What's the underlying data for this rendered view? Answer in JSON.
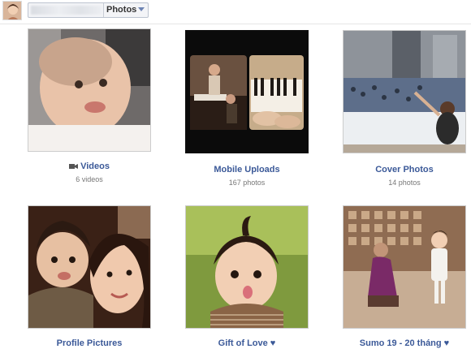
{
  "header": {
    "selector_label": "Photos"
  },
  "albums": [
    {
      "title": "Videos",
      "count": "6 videos",
      "icon": "video-camera-icon"
    },
    {
      "title": "Mobile Uploads",
      "count": "167 photos"
    },
    {
      "title": "Cover Photos",
      "count": "14 photos"
    },
    {
      "title": "Profile Pictures",
      "count": ""
    },
    {
      "title": "Gift of Love ♥",
      "count": ""
    },
    {
      "title": "Sumo 19 - 20 tháng ♥",
      "count": ""
    }
  ],
  "colors": {
    "link": "#3b5998",
    "muted": "#777777",
    "border": "#cccccc"
  }
}
